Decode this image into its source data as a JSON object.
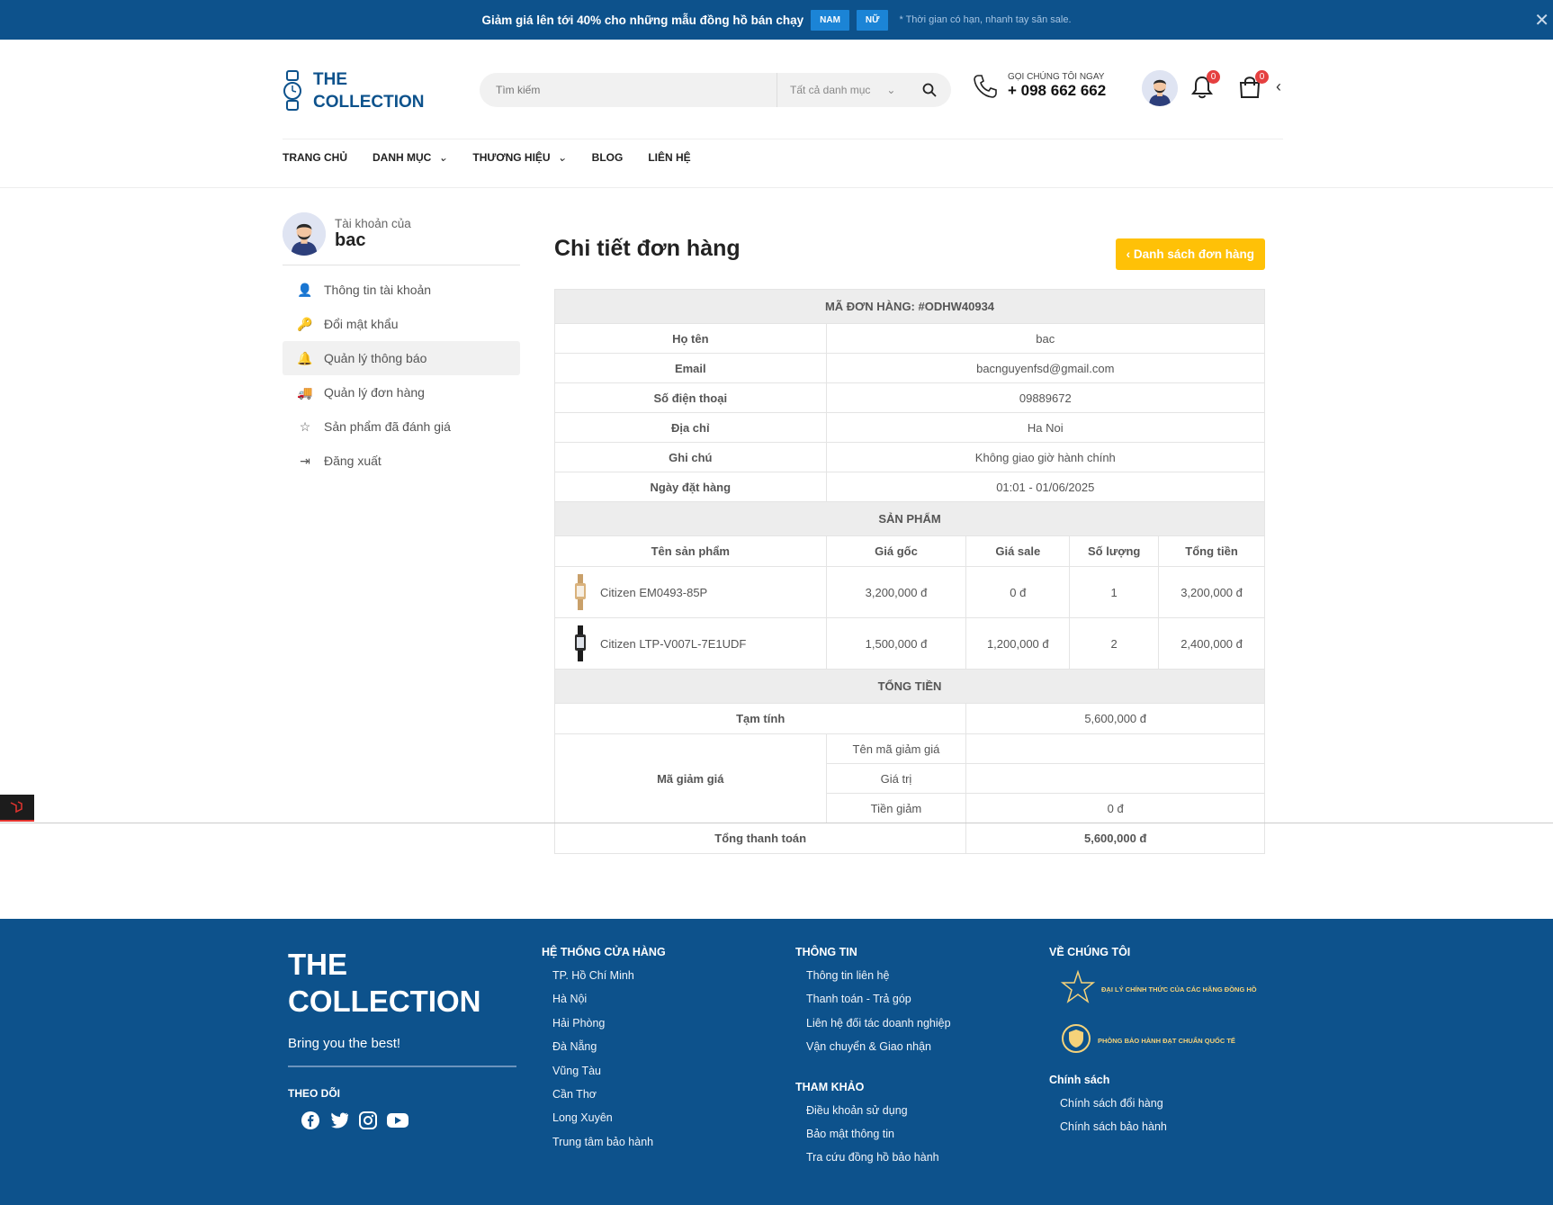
{
  "topbar": {
    "promo": "Giảm giá lên tới 40% cho những mẫu đồng hồ bán chạy",
    "tags": [
      "NAM",
      "NỮ"
    ],
    "note": "* Thời gian có hạn, nhanh tay săn sale."
  },
  "brand": {
    "line1": "THE",
    "line2": "COLLECTION"
  },
  "search": {
    "placeholder": "Tìm kiếm",
    "category": "Tất cả danh mục"
  },
  "hotline": {
    "label": "GỌI CHÚNG TÔI NGAY",
    "number": "+ 098 662 662"
  },
  "counts": {
    "notifications": "0",
    "cart": "0"
  },
  "nav": [
    "TRANG CHỦ",
    "DANH MỤC",
    "THƯƠNG HIỆU",
    "BLOG",
    "LIÊN HỆ"
  ],
  "account": {
    "label": "Tài khoản của",
    "name": "bac"
  },
  "menu": [
    "Thông tin tài khoản",
    "Đổi mật khẩu",
    "Quản lý thông báo",
    "Quản lý đơn hàng",
    "Sản phẩm đã đánh giá",
    "Đăng xuất"
  ],
  "page": {
    "title": "Chi tiết đơn hàng",
    "back": "Danh sách đơn hàng"
  },
  "order": {
    "code": "MÃ ĐƠN HÀNG: #ODHW40934",
    "info": [
      [
        "Họ tên",
        "bac"
      ],
      [
        "Email",
        "bacnguyenfsd@gmail.com"
      ],
      [
        "Số điện thoại",
        "09889672"
      ],
      [
        "Địa chỉ",
        "Ha Noi"
      ],
      [
        "Ghi chú",
        "Không giao giờ hành chính"
      ],
      [
        "Ngày đặt hàng",
        "01:01 - 01/06/2025"
      ]
    ],
    "products_header": "SẢN PHẨM",
    "columns": [
      "Tên sản phẩm",
      "Giá gốc",
      "Giá sale",
      "Số lượng",
      "Tổng tiền"
    ],
    "items": [
      {
        "name": "Citizen EM0493-85P",
        "price": "3,200,000 đ",
        "sale": "0 đ",
        "qty": "1",
        "total": "3,200,000 đ"
      },
      {
        "name": "Citizen LTP-V007L-7E1UDF",
        "price": "1,500,000 đ",
        "sale": "1,200,000 đ",
        "qty": "2",
        "total": "2,400,000 đ"
      }
    ],
    "totals_header": "TỔNG TIỀN",
    "subtotal_label": "Tạm tính",
    "subtotal": "5,600,000 đ",
    "discount_label": "Mã giảm giá",
    "discount_rows": [
      [
        "Tên mã giảm giá",
        ""
      ],
      [
        "Giá trị",
        ""
      ],
      [
        "Tiền giảm",
        "0 đ"
      ]
    ],
    "grand_label": "Tổng thanh toán",
    "grand": "5,600,000 đ"
  },
  "footer": {
    "brand1": "THE",
    "brand2": "COLLECTION",
    "tagline": "Bring you the best!",
    "follow": "THEO DÕI",
    "stores_title": "HỆ THỐNG CỬA HÀNG",
    "stores": [
      "TP. Hồ Chí Minh",
      "Hà Nội",
      "Hải Phòng",
      "Đà Nẵng",
      "Vũng Tàu",
      "Cần Thơ",
      "Long Xuyên",
      "Trung tâm bảo hành"
    ],
    "info_title": "THÔNG TIN",
    "info": [
      "Thông tin liên hệ",
      "Thanh toán - Trả góp",
      "Liên hệ đối tác doanh nghiệp",
      "Vận chuyển & Giao nhận"
    ],
    "ref_title": "THAM KHẢO",
    "ref": [
      "Điều khoản sử dụng",
      "Bảo mật thông tin",
      "Tra cứu đồng hồ bảo hành"
    ],
    "about_title": "VỀ CHÚNG TÔI",
    "cert1": "ĐẠI LÝ CHÍNH THỨC CỦA CÁC HÃNG ĐỒNG HỒ",
    "cert2": "PHÒNG BẢO HÀNH ĐẠT CHUẨN QUỐC TẾ",
    "policy_title": "Chính sách",
    "policy": [
      "Chính sách đổi hàng",
      "Chính sách bảo hành"
    ]
  },
  "colors": {
    "brand": "#0d528c",
    "accent": "#ffc107",
    "tag": "#1b84d6",
    "badge": "#e54040"
  }
}
